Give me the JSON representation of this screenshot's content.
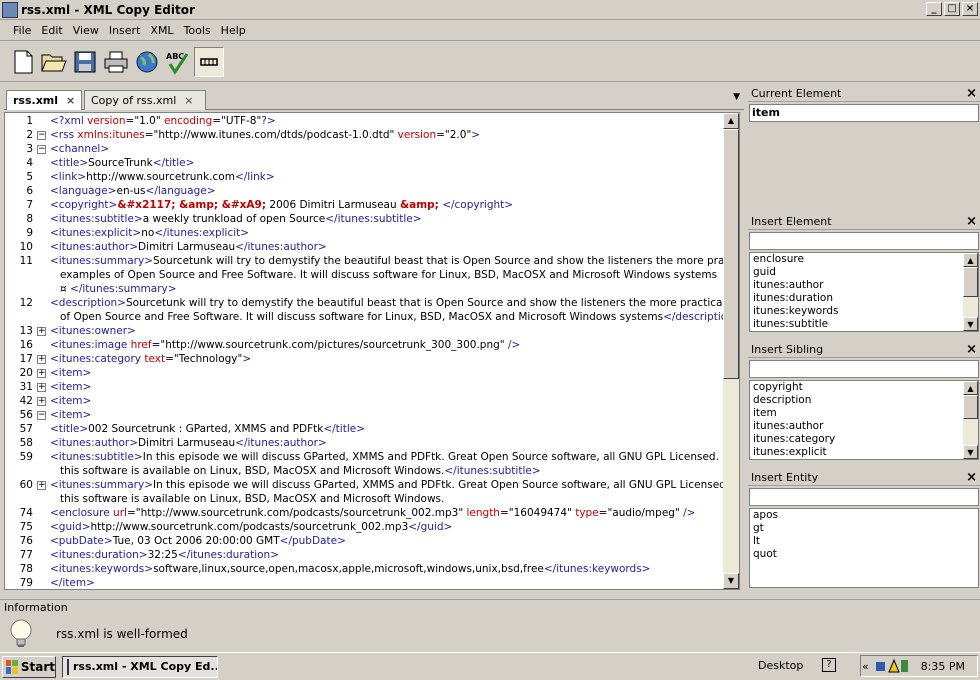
{
  "window": {
    "title": "rss.xml - XML Copy Editor",
    "min": "_",
    "max": "□",
    "close": "×"
  },
  "menu": [
    "File",
    "Edit",
    "View",
    "Insert",
    "XML",
    "Tools",
    "Help"
  ],
  "toolbar": [
    "new-icon",
    "open-icon",
    "save-icon",
    "print-icon",
    "browser-icon",
    "spellcheck-icon",
    "wrap-icon"
  ],
  "spellcheck_glyph": "ABC",
  "tabs": [
    {
      "label": "rss.xml",
      "close": "×"
    },
    {
      "label": "Copy of rss.xml",
      "close": "×"
    }
  ],
  "tab_menu_glyph": "▼",
  "fold": {
    "open": "−",
    "closed": "+"
  },
  "editor_lines": [
    {
      "n": "1",
      "fold": "",
      "segs": [
        [
          "t",
          "<?"
        ],
        [
          "t",
          "xml"
        ],
        [
          "a",
          " version"
        ],
        [
          "p",
          "=\"1.0\""
        ],
        [
          "a",
          " encoding"
        ],
        [
          "p",
          "=\"UTF-8\""
        ],
        [
          "t",
          "?>"
        ]
      ]
    },
    {
      "n": "2",
      "fold": "-",
      "segs": [
        [
          "t",
          "<rss"
        ],
        [
          "a",
          " xmlns:itunes"
        ],
        [
          "p",
          "=\"http://www.itunes.com/dtds/podcast-1.0.dtd\""
        ],
        [
          "a",
          " version"
        ],
        [
          "p",
          "=\"2.0\""
        ],
        [
          "t",
          ">"
        ]
      ]
    },
    {
      "n": "3",
      "fold": "-",
      "segs": [
        [
          "t",
          "<channel>"
        ]
      ]
    },
    {
      "n": "4",
      "fold": "",
      "segs": [
        [
          "t",
          "<title>"
        ],
        [
          "p",
          "SourceTrunk"
        ],
        [
          "t",
          "</title>"
        ]
      ]
    },
    {
      "n": "5",
      "fold": "",
      "segs": [
        [
          "t",
          "<link>"
        ],
        [
          "p",
          "http://www.sourcetrunk.com"
        ],
        [
          "t",
          "</link>"
        ]
      ]
    },
    {
      "n": "6",
      "fold": "",
      "segs": [
        [
          "t",
          "<language>"
        ],
        [
          "p",
          "en-us"
        ],
        [
          "t",
          "</language>"
        ]
      ]
    },
    {
      "n": "7",
      "fold": "",
      "segs": [
        [
          "t",
          "<copyright>"
        ],
        [
          "e",
          "&#x2117; &amp; &#xA9;"
        ],
        [
          "p",
          " 2006 Dimitri Larmuseau "
        ],
        [
          "e",
          "&amp;"
        ],
        [
          "p",
          " "
        ],
        [
          "t",
          "</copyright>"
        ]
      ]
    },
    {
      "n": "8",
      "fold": "",
      "segs": [
        [
          "t",
          "<itunes:subtitle>"
        ],
        [
          "p",
          "a weekly trunkload of open Source"
        ],
        [
          "t",
          "</itunes:subtitle>"
        ]
      ]
    },
    {
      "n": "9",
      "fold": "",
      "segs": [
        [
          "t",
          "<itunes:explicit>"
        ],
        [
          "p",
          "no"
        ],
        [
          "t",
          "</itunes:explicit>"
        ]
      ]
    },
    {
      "n": "10",
      "fold": "",
      "segs": [
        [
          "t",
          "<itunes:author>"
        ],
        [
          "p",
          "Dimitri Larmuseau"
        ],
        [
          "t",
          "</itunes:author>"
        ]
      ]
    },
    {
      "n": "11",
      "fold": "",
      "segs": [
        [
          "t",
          "<itunes:summary>"
        ],
        [
          "p",
          "Sourcetunk will try to demystify the beautiful beast that is Open Source and show the listeners the more practical"
        ]
      ]
    },
    {
      "n": "",
      "fold": "",
      "indent": 1,
      "segs": [
        [
          "p",
          "examples of Open Source and Free Software. It will discuss software for Linux, BSD, MacOSX and Microsoft Windows systems"
        ]
      ]
    },
    {
      "n": "",
      "fold": "",
      "indent": 1,
      "segs": [
        [
          "p",
          "¤ "
        ],
        [
          "t",
          "</itunes:summary>"
        ]
      ]
    },
    {
      "n": "12",
      "fold": "",
      "segs": [
        [
          "t",
          "<description>"
        ],
        [
          "p",
          "Sourcetunk will try to demystify the beautiful beast that is Open Source and show the listeners the more practical examples"
        ]
      ]
    },
    {
      "n": "",
      "fold": "",
      "indent": 1,
      "segs": [
        [
          "p",
          "of Open Source and Free Software. It will discuss software for Linux, BSD, MacOSX and Microsoft Windows systems"
        ],
        [
          "t",
          "</description>"
        ]
      ]
    },
    {
      "n": "13",
      "fold": "+",
      "segs": [
        [
          "t",
          "<itunes:owner>"
        ]
      ]
    },
    {
      "n": "16",
      "fold": "",
      "segs": [
        [
          "t",
          "<itunes:image"
        ],
        [
          "a",
          " href"
        ],
        [
          "p",
          "=\"http://www.sourcetrunk.com/pictures/sourcetrunk_300_300.png\""
        ],
        [
          "t",
          " />"
        ]
      ]
    },
    {
      "n": "17",
      "fold": "+",
      "segs": [
        [
          "t",
          "<itunes:category"
        ],
        [
          "a",
          " text"
        ],
        [
          "p",
          "=\"Technology\""
        ],
        [
          "t",
          ">"
        ]
      ]
    },
    {
      "n": "20",
      "fold": "+",
      "segs": [
        [
          "t",
          "<item>"
        ]
      ]
    },
    {
      "n": "31",
      "fold": "+",
      "segs": [
        [
          "t",
          "<item>"
        ]
      ]
    },
    {
      "n": "42",
      "fold": "+",
      "segs": [
        [
          "t",
          "<item>"
        ]
      ]
    },
    {
      "n": "56",
      "fold": "-",
      "segs": [
        [
          "t",
          "<item>"
        ]
      ]
    },
    {
      "n": "57",
      "fold": "",
      "segs": [
        [
          "t",
          "<title>"
        ],
        [
          "p",
          "002 Sourcetrunk : GParted, XMMS and PDFtk"
        ],
        [
          "t",
          "</title>"
        ]
      ]
    },
    {
      "n": "58",
      "fold": "",
      "segs": [
        [
          "t",
          "<itunes:author>"
        ],
        [
          "p",
          "Dimitri Larmuseau"
        ],
        [
          "t",
          "</itunes:author>"
        ]
      ]
    },
    {
      "n": "59",
      "fold": "",
      "segs": [
        [
          "t",
          "<itunes:subtitle>"
        ],
        [
          "p",
          "In this episode we will discuss GParted, XMMS and PDFtk. Great Open Source software, all GNU GPL Licensed. most of"
        ]
      ]
    },
    {
      "n": "",
      "fold": "",
      "indent": 1,
      "segs": [
        [
          "p",
          "this software is available on Linux, BSD, MacOSX and Microsoft Windows."
        ],
        [
          "t",
          "</itunes:subtitle>"
        ]
      ]
    },
    {
      "n": "60",
      "fold": "+",
      "segs": [
        [
          "t",
          "<itunes:summary>"
        ],
        [
          "p",
          "In this episode we will discuss GParted, XMMS and PDFtk. Great Open Source software, all GNU GPL Licensed. most of"
        ]
      ]
    },
    {
      "n": "",
      "fold": "",
      "indent": 1,
      "segs": [
        [
          "p",
          "this software is available on Linux, BSD, MacOSX and Microsoft Windows."
        ]
      ]
    },
    {
      "n": "74",
      "fold": "",
      "segs": [
        [
          "t",
          "<enclosure"
        ],
        [
          "a",
          " url"
        ],
        [
          "p",
          "=\"http://www.sourcetrunk.com/podcasts/sourcetrunk_002.mp3\""
        ],
        [
          "a",
          " length"
        ],
        [
          "p",
          "=\"16049474\""
        ],
        [
          "a",
          " type"
        ],
        [
          "p",
          "=\"audio/mpeg\""
        ],
        [
          "t",
          " />"
        ]
      ]
    },
    {
      "n": "75",
      "fold": "",
      "segs": [
        [
          "t",
          "<guid>"
        ],
        [
          "p",
          "http://www.sourcetrunk.com/podcasts/sourcetrunk_002.mp3"
        ],
        [
          "t",
          "</guid>"
        ]
      ]
    },
    {
      "n": "76",
      "fold": "",
      "segs": [
        [
          "t",
          "<pubDate>"
        ],
        [
          "p",
          "Tue, 03 Oct 2006 20:00:00 GMT"
        ],
        [
          "t",
          "</pubDate>"
        ]
      ]
    },
    {
      "n": "77",
      "fold": "",
      "segs": [
        [
          "t",
          "<itunes:duration>"
        ],
        [
          "p",
          "32:25"
        ],
        [
          "t",
          "</itunes:duration>"
        ]
      ]
    },
    {
      "n": "78",
      "fold": "",
      "segs": [
        [
          "t",
          "<itunes:keywords>"
        ],
        [
          "p",
          "software,linux,source,open,macosx,apple,microsoft,windows,unix,bsd,free"
        ],
        [
          "t",
          "</itunes:keywords>"
        ]
      ]
    },
    {
      "n": "79",
      "fold": "",
      "segs": [
        [
          "t",
          "</item>"
        ]
      ]
    },
    {
      "n": "80",
      "fold": "+",
      "segs": [
        [
          "t",
          "<item>"
        ]
      ]
    }
  ],
  "scroll": {
    "up": "▲",
    "down": "▼"
  },
  "panels": {
    "current_element": {
      "title": "Current Element",
      "close": "×",
      "value": "item"
    },
    "insert_element": {
      "title": "Insert Element",
      "close": "×",
      "input": "",
      "items": [
        "enclosure",
        "guid",
        "itunes:author",
        "itunes:duration",
        "itunes:keywords",
        "itunes:subtitle"
      ]
    },
    "insert_sibling": {
      "title": "Insert Sibling",
      "close": "×",
      "input": "",
      "items": [
        "copyright",
        "description",
        "item",
        "itunes:author",
        "itunes:category",
        "itunes:explicit"
      ]
    },
    "insert_entity": {
      "title": "Insert Entity",
      "close": "×",
      "input": "",
      "items": [
        "apos",
        "gt",
        "lt",
        "quot"
      ]
    }
  },
  "info": {
    "title": "Information",
    "message": "rss.xml is well-formed"
  },
  "taskbar": {
    "start": "Start",
    "task": "rss.xml - XML Copy Ed...",
    "desktop": "Desktop",
    "help": "?",
    "tray_arrow": "«",
    "clock": "8:35 PM"
  },
  "colors": {
    "tag": "#1f1f9a",
    "attr": "#c00000",
    "entity": "#c00000",
    "chrome": "#d4d0c8"
  }
}
